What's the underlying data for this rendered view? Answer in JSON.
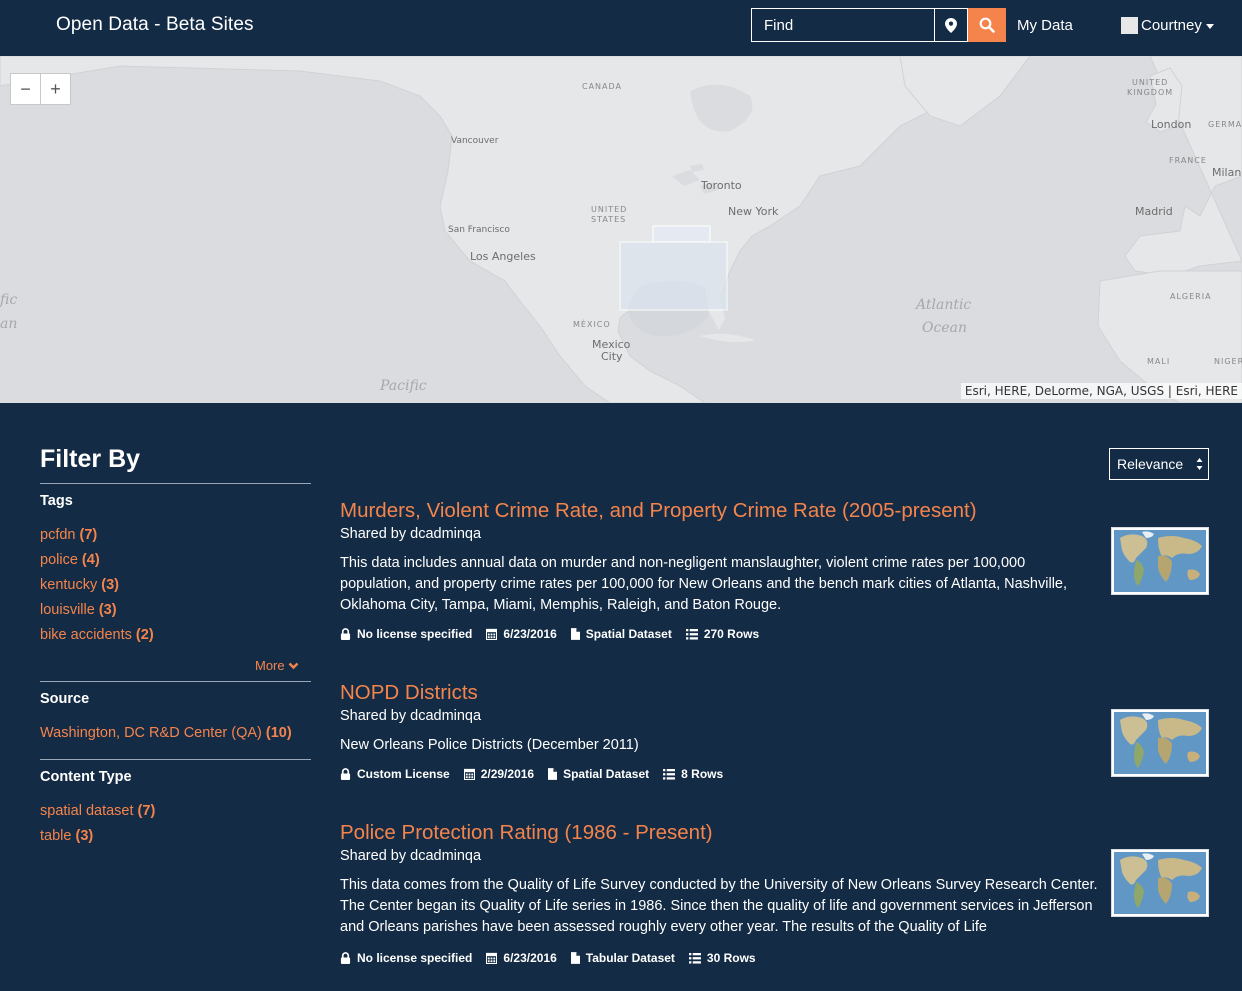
{
  "header": {
    "brand": "Open Data - Beta Sites",
    "search_placeholder": "Find",
    "my_data": "My Data",
    "user_name": "Courtney"
  },
  "map": {
    "zoom_out": "−",
    "zoom_in": "+",
    "labels": {
      "canada": "CANADA",
      "united_kingdom_1": "UNITED",
      "united_kingdom_2": "KINGDOM",
      "london": "London",
      "germany": "GERMA",
      "vancouver": "Vancouver",
      "france": "FRANCE",
      "milan": "Milan",
      "toronto": "Toronto",
      "united_states_1": "UNITED",
      "united_states_2": "STATES",
      "new_york": "New York",
      "madrid": "Madrid",
      "san_francisco": "San Francisco",
      "los_angeles": "Los Angeles",
      "pacific_left_1": "fic",
      "pacific_left_2": "an",
      "atlantic_1": "Atlantic",
      "atlantic_2": "Ocean",
      "algeria": "ALGERIA",
      "mexico_country": "MÉXICO",
      "mexico_city_1": "Mexico",
      "mexico_city_2": "City",
      "mali": "MALI",
      "niger": "NIGER",
      "pacific": "Pacific"
    },
    "attribution": "Esri, HERE, DeLorme, NGA, USGS | Esri, HERE"
  },
  "filters": {
    "title": "Filter By",
    "tags": {
      "heading": "Tags",
      "items": [
        {
          "label": "pcfdn",
          "count": "(7)"
        },
        {
          "label": "police",
          "count": "(4)"
        },
        {
          "label": "kentucky",
          "count": "(3)"
        },
        {
          "label": "louisville",
          "count": "(3)"
        },
        {
          "label": "bike accidents",
          "count": "(2)"
        }
      ],
      "more_label": "More"
    },
    "source": {
      "heading": "Source",
      "items": [
        {
          "label": "Washington, DC R&D Center (QA)",
          "count": "(10)"
        }
      ]
    },
    "content_type": {
      "heading": "Content Type",
      "items": [
        {
          "label": "spatial dataset",
          "count": "(7)"
        },
        {
          "label": "table",
          "count": "(3)"
        }
      ]
    }
  },
  "sort": {
    "selected": "Relevance"
  },
  "results": [
    {
      "title": "Murders, Violent Crime Rate, and Property Crime Rate (2005-present)",
      "shared_by": "Shared by dcadminqa",
      "description": "This data includes annual data on murder and non-negligent manslaughter, violent crime rates per 100,000 population, and property crime rates per 100,000 for New Orleans and the bench mark cities of Atlanta, Nashville, Oklahoma City, Tampa, Miami, Memphis, Raleigh, and Baton Rouge.",
      "license": "No license specified",
      "date": "6/23/2016",
      "type": "Spatial Dataset",
      "rows": "270 Rows"
    },
    {
      "title": "NOPD Districts",
      "shared_by": "Shared by dcadminqa",
      "description": "New Orleans Police Districts (December 2011)",
      "license": "Custom License",
      "date": "2/29/2016",
      "type": "Spatial Dataset",
      "rows": "8 Rows"
    },
    {
      "title": "Police Protection Rating (1986 - Present)",
      "shared_by": "Shared by dcadminqa",
      "description": "This data comes from the Quality of Life Survey conducted by the University of New Orleans Survey Research Center. The Center began its Quality of Life series in 1986. Since then the quality of life and government services in Jefferson and Orleans parishes have been assessed roughly every other year. The results of the Quality of Life",
      "license": "No license specified",
      "date": "6/23/2016",
      "type": "Tabular Dataset",
      "rows": "30 Rows"
    }
  ],
  "colors": {
    "background": "#132b44",
    "accent": "#f5844c",
    "map_land": "#e6e7e9",
    "map_water": "#dadcdf"
  }
}
